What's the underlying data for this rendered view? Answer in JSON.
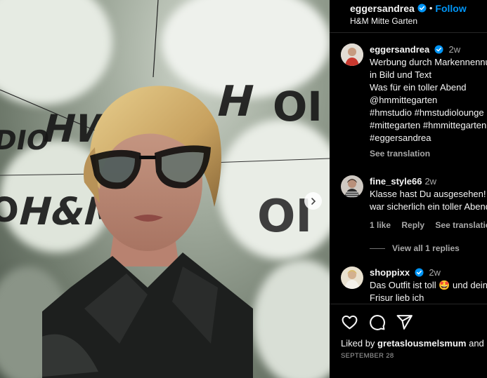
{
  "header": {
    "username": "eggersandrea",
    "separator": "•",
    "follow_label": "Follow",
    "location": "H&M Mitte Garten"
  },
  "caption": {
    "username": "eggersandrea",
    "time": "2w",
    "lines": [
      "Werbung durch Markennennung",
      "in Bild und Text",
      "Was für ein toller Abend",
      "@hmmittegarten",
      "#hmstudio #hmstudiolounge",
      "#mittegarten #hmmittegarten",
      "#eggersandrea"
    ],
    "see_translation": "See translation"
  },
  "comments": [
    {
      "username": "fine_style66",
      "time": "2w",
      "lines": [
        "Klasse hast Du ausgesehen! Es",
        "war sicherlich ein toller Abend"
      ],
      "likes": "1 like",
      "reply": "Reply",
      "see_translation": "See translation",
      "view_replies": "View all 1 replies"
    },
    {
      "username": "shoppixx",
      "time": "2w",
      "lines": [
        "Das Outfit ist toll 🤩 und deine",
        "Frisur lieb ich"
      ]
    }
  ],
  "footer": {
    "liked_prefix": "Liked by ",
    "liked_user": "gretaslousmelsmum",
    "liked_suffix": " and",
    "date": "SEPTEMBER 28"
  },
  "media": {
    "logo_words": [
      "OI",
      "DIO",
      "HW",
      "H",
      "O",
      "H&M",
      "OI"
    ]
  },
  "colors": {
    "accent": "#0095f6",
    "verified": "#0095f6",
    "background": "#000000",
    "secondary_text": "#a8a8a8"
  },
  "icons": {
    "like": "heart-icon",
    "comment": "comment-icon",
    "share": "share-icon",
    "next": "chevron-right-icon",
    "verified": "verified-badge-icon"
  }
}
